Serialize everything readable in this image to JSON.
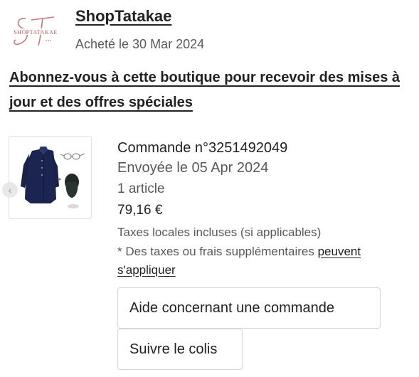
{
  "shop": {
    "logo_text": "ShopTatakae",
    "name": "ShopTatakae",
    "purchase_date": "Acheté le 30 Mar 2024"
  },
  "subscribe": {
    "text": "Abonnez-vous à cette boutique pour recevoir des mises à jour et des offres spéciales"
  },
  "order": {
    "number": "Commande n°3251492049",
    "shipped": "Envoyée le 05 Apr 2024",
    "item_count": "1 article",
    "price": "79,16 €",
    "tax_note": "Taxes locales incluses (si applicables)",
    "extra_note_prefix": "* Des taxes ou frais supplémentaires ",
    "extra_note_link": "peuvent s'appliquer"
  },
  "actions": {
    "help_label": "Aide concernant une commande",
    "track_label": "Suivre le colis"
  },
  "icons": {
    "thumb_nav": "chevron-left-icon"
  },
  "colors": {
    "text_primary": "#222222",
    "text_secondary": "#595959",
    "logo_red": "#c47a7a"
  }
}
